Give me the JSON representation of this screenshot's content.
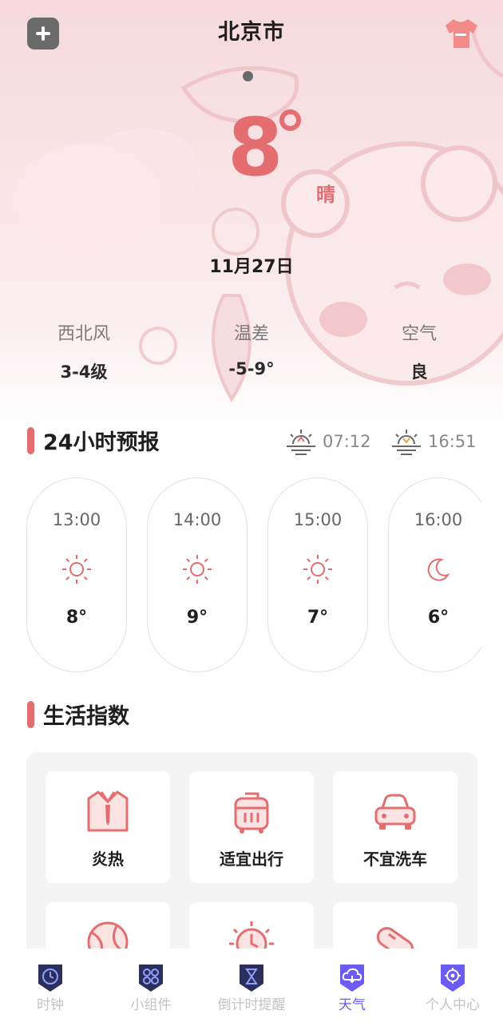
{
  "header": {
    "city": "北京市",
    "add_icon": "plus-icon",
    "theme_icon": "tshirt-icon"
  },
  "current": {
    "temperature": "8",
    "condition": "晴",
    "date": "11月27日"
  },
  "stats": [
    {
      "label": "西北风",
      "value": "3-4级"
    },
    {
      "label": "温差",
      "value": "-5-9°"
    },
    {
      "label": "空气",
      "value": "良"
    }
  ],
  "forecast": {
    "title": "24小时预报",
    "sunrise": "07:12",
    "sunset": "16:51",
    "hours": [
      {
        "time": "13:00",
        "icon": "sun-icon",
        "temp": "8°"
      },
      {
        "time": "14:00",
        "icon": "sun-icon",
        "temp": "9°"
      },
      {
        "time": "15:00",
        "icon": "sun-icon",
        "temp": "7°"
      },
      {
        "time": "16:00",
        "icon": "moon-icon",
        "temp": "6°"
      }
    ]
  },
  "life": {
    "title": "生活指数",
    "items": [
      {
        "label": "炎热",
        "icon": "shirt-icon"
      },
      {
        "label": "适宜出行",
        "icon": "luggage-icon"
      },
      {
        "label": "不宜洗车",
        "icon": "car-icon"
      },
      {
        "label": "",
        "icon": "ball-icon"
      },
      {
        "label": "",
        "icon": "sun-timer-icon"
      },
      {
        "label": "",
        "icon": "pill-icon"
      }
    ]
  },
  "tabs": [
    {
      "label": "时钟",
      "icon": "clock-icon"
    },
    {
      "label": "小组件",
      "icon": "widgets-icon"
    },
    {
      "label": "倒计时提醒",
      "icon": "hourglass-icon"
    },
    {
      "label": "天气",
      "icon": "weather-cloud-icon",
      "active": true
    },
    {
      "label": "个人中心",
      "icon": "settings-gear-icon"
    }
  ],
  "colors": {
    "accent": "#e46d6f",
    "active_tab": "#6a5cf2",
    "tab_icon_dark": "#2b2f5c"
  }
}
